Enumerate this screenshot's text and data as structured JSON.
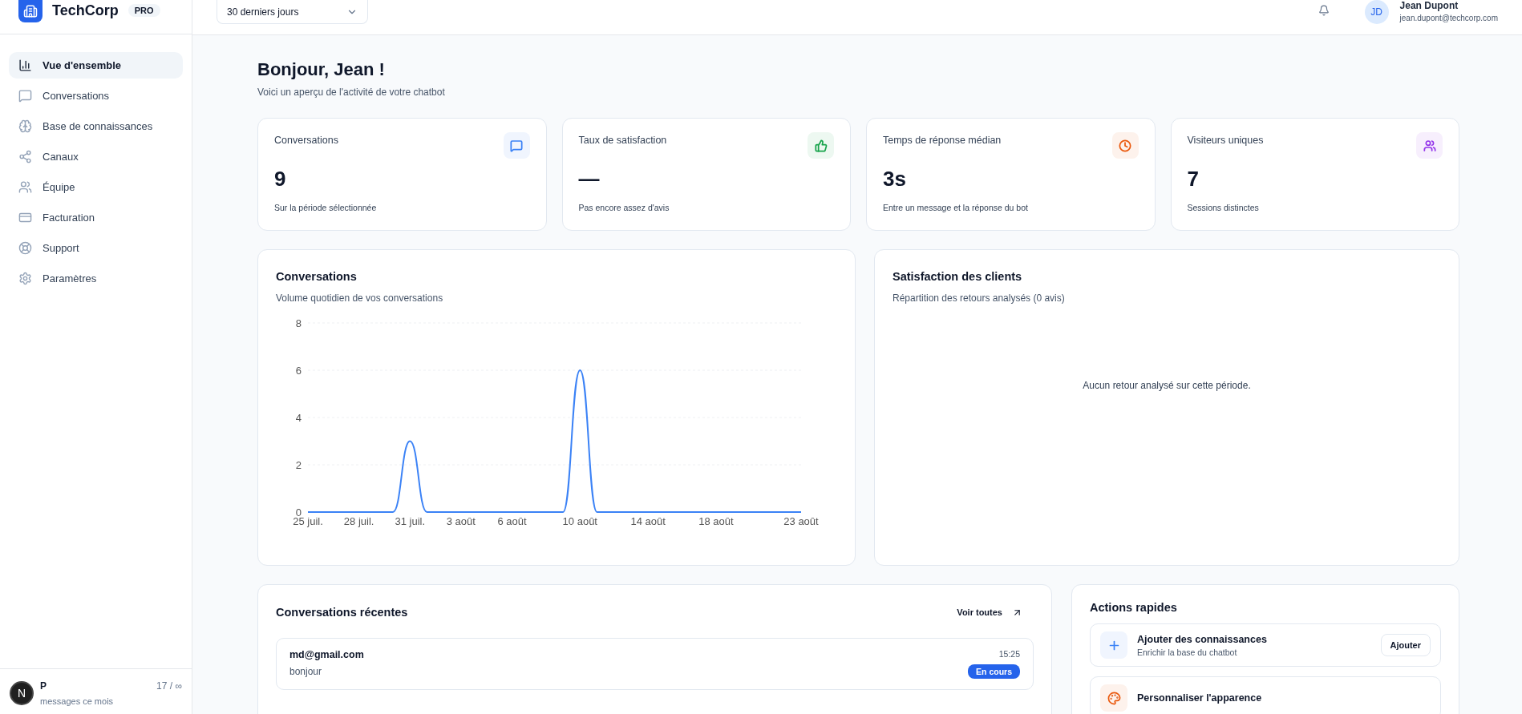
{
  "brand": {
    "name": "TechCorp",
    "plan": "PRO"
  },
  "sidebar": {
    "items": [
      {
        "label": "Vue d'ensemble",
        "selected": true
      },
      {
        "label": "Conversations",
        "selected": false
      },
      {
        "label": "Base de connaissances",
        "selected": false
      },
      {
        "label": "Canaux",
        "selected": false
      },
      {
        "label": "Équipe",
        "selected": false
      },
      {
        "label": "Facturation",
        "selected": false
      },
      {
        "label": "Support",
        "selected": false
      },
      {
        "label": "Paramètres",
        "selected": false
      }
    ],
    "footer": {
      "label": "P",
      "count": "17 / ∞",
      "caption": "messages ce mois",
      "dev_badge": "N"
    }
  },
  "header": {
    "period": "30 derniers jours",
    "user": {
      "initials": "JD",
      "name": "Jean Dupont",
      "email": "jean.dupont@techcorp.com"
    }
  },
  "greeting": {
    "title": "Bonjour, Jean !",
    "subtitle": "Voici un aperçu de l'activité de votre chatbot"
  },
  "stats": [
    {
      "label": "Conversations",
      "value": "9",
      "caption": "Sur la période sélectionnée",
      "color": "#3b82f6"
    },
    {
      "label": "Taux de satisfaction",
      "value": "—",
      "caption": "Pas encore assez d'avis",
      "color": "#16a34a"
    },
    {
      "label": "Temps de réponse médian",
      "value": "3s",
      "caption": "Entre un message et la réponse du bot",
      "color": "#ea580c"
    },
    {
      "label": "Visiteurs uniques",
      "value": "7",
      "caption": "Sessions distinctes",
      "color": "#9333ea"
    }
  ],
  "conversations_chart": {
    "title": "Conversations",
    "subtitle": "Volume quotidien de vos conversations",
    "chart_data": {
      "type": "line",
      "categories": [
        "25 juil.",
        null,
        null,
        "28 juil.",
        null,
        null,
        "31 juil.",
        null,
        null,
        "3 août",
        null,
        null,
        "6 août",
        null,
        null,
        null,
        "10 août",
        null,
        null,
        null,
        "14 août",
        null,
        null,
        null,
        "18 août",
        null,
        null,
        null,
        null,
        "23 août"
      ],
      "series": [
        {
          "color": "#3b82f6",
          "values": [
            0,
            0,
            0,
            0,
            0,
            0,
            3,
            0,
            0,
            0,
            0,
            0,
            0,
            0,
            0,
            0,
            6,
            0,
            0,
            0,
            0,
            0,
            0,
            0,
            0,
            0,
            0,
            0,
            0,
            0
          ]
        }
      ],
      "ylim": [
        0,
        8
      ],
      "yticks": [
        0,
        2,
        4,
        6,
        8
      ],
      "grid": true
    }
  },
  "satisfaction": {
    "title": "Satisfaction des clients",
    "subtitle": "Répartition des retours analysés (0 avis)",
    "empty": "Aucun retour analysé sur cette période."
  },
  "recent": {
    "title": "Conversations récentes",
    "link": "Voir toutes",
    "items": [
      {
        "email": "md@gmail.com",
        "message": "bonjour",
        "time": "15:25",
        "status": "En cours"
      }
    ]
  },
  "quick_actions": {
    "title": "Actions rapides",
    "items": [
      {
        "title": "Ajouter des connaissances",
        "caption": "Enrichir la base du chatbot",
        "button": "Ajouter",
        "color": "#3b82f6"
      },
      {
        "title": "Personnaliser l'apparence",
        "color": "#ea580c"
      }
    ]
  }
}
